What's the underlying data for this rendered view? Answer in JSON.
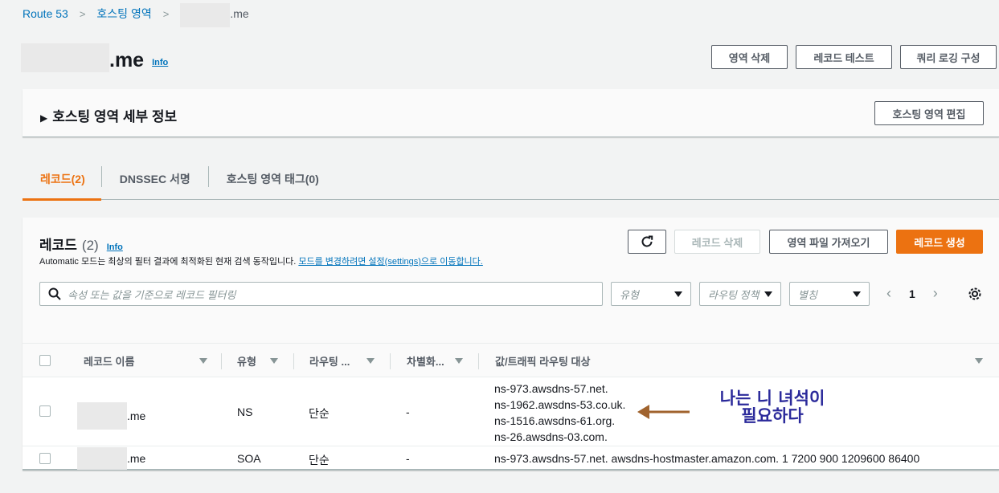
{
  "breadcrumb": {
    "root": "Route 53",
    "parent": "호스팅 영역",
    "current_suffix": ".me"
  },
  "page": {
    "title_suffix": ".me",
    "info": "Info"
  },
  "header_buttons": {
    "delete_zone": "영역 삭제",
    "test_record": "레코드 테스트",
    "query_logging": "쿼리 로깅 구성"
  },
  "details": {
    "title": "호스팅 영역 세부 정보",
    "edit_button": "호스팅 영역 편집"
  },
  "tabs": [
    {
      "label": "레코드(2)",
      "active": true
    },
    {
      "label": "DNSSEC 서명",
      "active": false
    },
    {
      "label": "호스팅 영역 태그(0)",
      "active": false
    }
  ],
  "records": {
    "title": "레코드",
    "count": "(2)",
    "info": "Info",
    "description_prefix": "Automatic 모드는 최상의 필터 결과에 최적화된 현재 검색 동작입니다.",
    "description_link": "모드를 변경하려면 설정(settings)으로 이동합니다.",
    "delete_button": "레코드 삭제",
    "import_button": "영역 파일 가져오기",
    "create_button": "레코드 생성",
    "search_placeholder": "속성 또는 값을 기준으로 레코드 필터링",
    "filter_type": "유형",
    "filter_routing": "라우팅 정책",
    "filter_alias": "별칭",
    "page": "1",
    "columns": {
      "name": "레코드 이름",
      "type": "유형",
      "routing": "라우팅 ...",
      "differentiator": "차별화...",
      "value": "값/트래픽 라우팅 대상"
    },
    "rows": [
      {
        "name_suffix": ".me",
        "type": "NS",
        "routing": "단순",
        "differentiator": "-",
        "values": [
          "ns-973.awsdns-57.net.",
          "ns-1962.awsdns-53.co.uk.",
          "ns-1516.awsdns-61.org.",
          "ns-26.awsdns-03.com."
        ]
      },
      {
        "name_suffix": ".me",
        "type": "SOA",
        "routing": "단순",
        "differentiator": "-",
        "values": [
          "ns-973.awsdns-57.net. awsdns-hostmaster.amazon.com. 1 7200 900 1209600 86400"
        ]
      }
    ]
  },
  "annotation": {
    "line1": "나는 니 녀석이",
    "line2": "필요하다",
    "color": "#2b2a9b",
    "arrow_color": "#a0632e"
  },
  "colors": {
    "accent": "#ec7211",
    "link": "#0073bb"
  }
}
